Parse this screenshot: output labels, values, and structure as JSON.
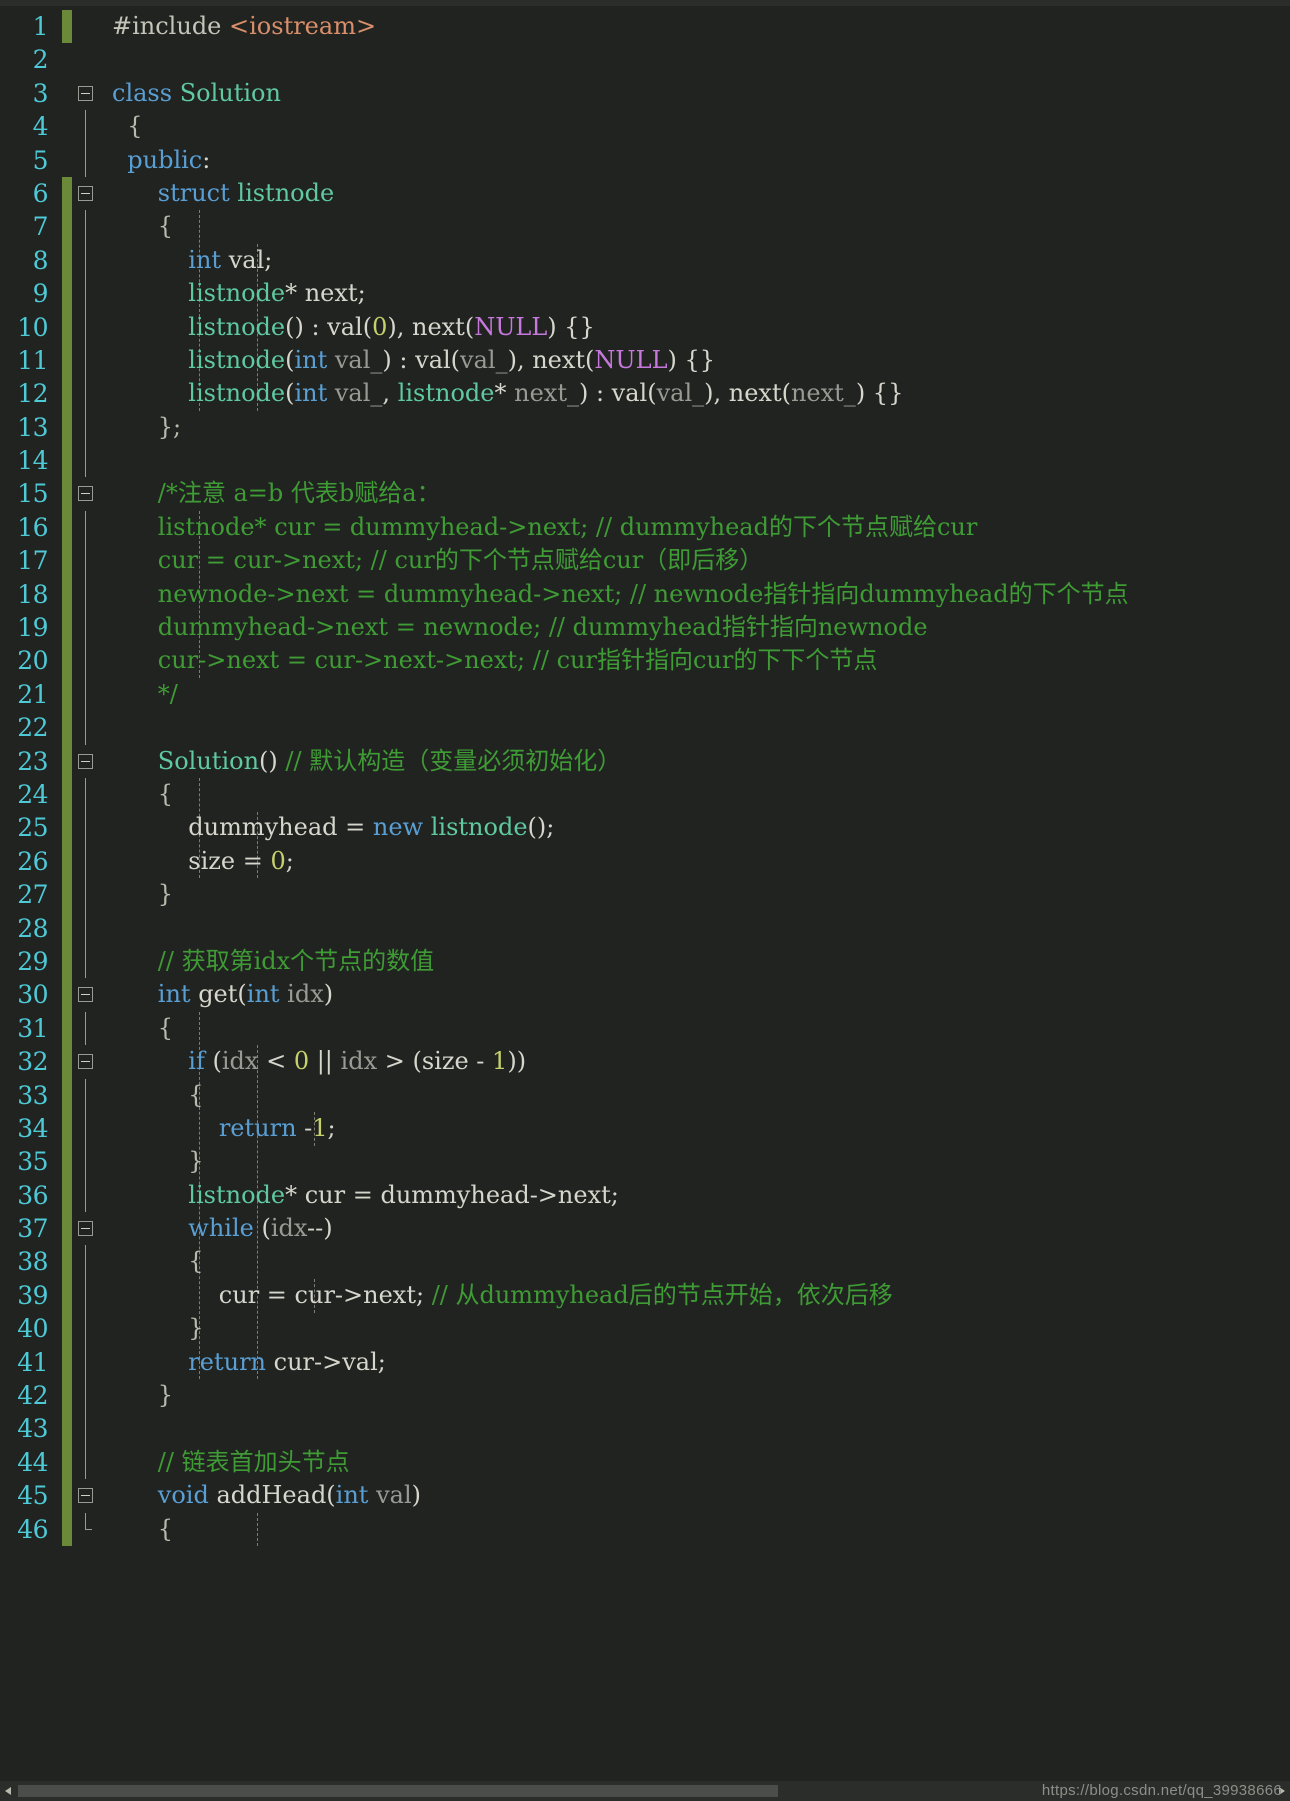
{
  "editor": {
    "language": "C++",
    "theme": "dark",
    "colors": {
      "background": "#212321",
      "line_number": "#4ec9d6",
      "keyword": "#5a9fd4",
      "type": "#5fc9a0",
      "comment": "#3f9c35",
      "string": "#d98f6a",
      "number": "#c6d16b",
      "macro": "#c678dd",
      "parameter": "#9a9a94",
      "plain": "#d6d6cc",
      "change_bar": "#6a8a3a",
      "scrollbar_track": "#2b2d2b",
      "scrollbar_thumb": "#4a4d4a"
    },
    "first_line": 1,
    "last_line": 46,
    "total_visible_lines": 46
  },
  "watermark": "https://blog.csdn.net/qq_39938666",
  "scrollbar": {
    "left_arrow": "scroll-left",
    "right_arrow": "scroll-right"
  },
  "lines": [
    {
      "n": "1",
      "tokens": [
        {
          "t": "#include ",
          "c": "pre"
        },
        {
          "t": "<iostream>",
          "c": "str"
        }
      ]
    },
    {
      "n": "2",
      "tokens": []
    },
    {
      "n": "3",
      "tokens": [
        {
          "t": "class ",
          "c": "kw"
        },
        {
          "t": "Solution",
          "c": "typ"
        }
      ]
    },
    {
      "n": "4",
      "tokens": [
        {
          "t": "  {",
          "c": "brc"
        }
      ]
    },
    {
      "n": "5",
      "tokens": [
        {
          "t": "  ",
          "c": "pln"
        },
        {
          "t": "public",
          "c": "kw"
        },
        {
          "t": ":",
          "c": "pln"
        }
      ]
    },
    {
      "n": "6",
      "tokens": [
        {
          "t": "      ",
          "c": "pln"
        },
        {
          "t": "struct ",
          "c": "kw"
        },
        {
          "t": "listnode",
          "c": "typ"
        }
      ]
    },
    {
      "n": "7",
      "tokens": [
        {
          "t": "      {",
          "c": "brc"
        }
      ]
    },
    {
      "n": "8",
      "tokens": [
        {
          "t": "          ",
          "c": "pln"
        },
        {
          "t": "int ",
          "c": "kw"
        },
        {
          "t": "val;",
          "c": "pln"
        }
      ]
    },
    {
      "n": "9",
      "tokens": [
        {
          "t": "          ",
          "c": "pln"
        },
        {
          "t": "listnode",
          "c": "typ"
        },
        {
          "t": "* next;",
          "c": "pln"
        }
      ]
    },
    {
      "n": "10",
      "tokens": [
        {
          "t": "          ",
          "c": "pln"
        },
        {
          "t": "listnode",
          "c": "typ"
        },
        {
          "t": "() : val(",
          "c": "pln"
        },
        {
          "t": "0",
          "c": "num"
        },
        {
          "t": "), next(",
          "c": "pln"
        },
        {
          "t": "NULL",
          "c": "mac"
        },
        {
          "t": ") {}",
          "c": "pln"
        }
      ]
    },
    {
      "n": "11",
      "tokens": [
        {
          "t": "          ",
          "c": "pln"
        },
        {
          "t": "listnode",
          "c": "typ"
        },
        {
          "t": "(",
          "c": "pln"
        },
        {
          "t": "int ",
          "c": "kw"
        },
        {
          "t": "val_",
          "c": "par"
        },
        {
          "t": ") : val(",
          "c": "pln"
        },
        {
          "t": "val_",
          "c": "par"
        },
        {
          "t": "), next(",
          "c": "pln"
        },
        {
          "t": "NULL",
          "c": "mac"
        },
        {
          "t": ") {}",
          "c": "pln"
        }
      ]
    },
    {
      "n": "12",
      "tokens": [
        {
          "t": "          ",
          "c": "pln"
        },
        {
          "t": "listnode",
          "c": "typ"
        },
        {
          "t": "(",
          "c": "pln"
        },
        {
          "t": "int ",
          "c": "kw"
        },
        {
          "t": "val_",
          "c": "par"
        },
        {
          "t": ", ",
          "c": "pln"
        },
        {
          "t": "listnode",
          "c": "typ"
        },
        {
          "t": "* ",
          "c": "pln"
        },
        {
          "t": "next_",
          "c": "par"
        },
        {
          "t": ") : val(",
          "c": "pln"
        },
        {
          "t": "val_",
          "c": "par"
        },
        {
          "t": "), next(",
          "c": "pln"
        },
        {
          "t": "next_",
          "c": "par"
        },
        {
          "t": ") {}",
          "c": "pln"
        }
      ]
    },
    {
      "n": "13",
      "tokens": [
        {
          "t": "      };",
          "c": "brc"
        }
      ]
    },
    {
      "n": "14",
      "tokens": []
    },
    {
      "n": "15",
      "tokens": [
        {
          "t": "      /*注意 a=b 代表b赋给a：",
          "c": "cmt"
        }
      ]
    },
    {
      "n": "16",
      "tokens": [
        {
          "t": "      listnode* cur = dummyhead->next; // dummyhead的下个节点赋给cur",
          "c": "cmt"
        }
      ]
    },
    {
      "n": "17",
      "tokens": [
        {
          "t": "      cur = cur->next; // cur的下个节点赋给cur（即后移）",
          "c": "cmt"
        }
      ]
    },
    {
      "n": "18",
      "tokens": [
        {
          "t": "      newnode->next = dummyhead->next; // newnode指针指向dummyhead的下个节点",
          "c": "cmt"
        }
      ]
    },
    {
      "n": "19",
      "tokens": [
        {
          "t": "      dummyhead->next = newnode; // dummyhead指针指向newnode",
          "c": "cmt"
        }
      ]
    },
    {
      "n": "20",
      "tokens": [
        {
          "t": "      cur->next = cur->next->next; // cur指针指向cur的下下个节点",
          "c": "cmt"
        }
      ]
    },
    {
      "n": "21",
      "tokens": [
        {
          "t": "      */",
          "c": "cmt"
        }
      ]
    },
    {
      "n": "22",
      "tokens": []
    },
    {
      "n": "23",
      "tokens": [
        {
          "t": "      ",
          "c": "pln"
        },
        {
          "t": "Solution",
          "c": "typ"
        },
        {
          "t": "() ",
          "c": "pln"
        },
        {
          "t": "// 默认构造（变量必须初始化）",
          "c": "cmt"
        }
      ]
    },
    {
      "n": "24",
      "tokens": [
        {
          "t": "      {",
          "c": "brc"
        }
      ]
    },
    {
      "n": "25",
      "tokens": [
        {
          "t": "          dummyhead = ",
          "c": "pln"
        },
        {
          "t": "new ",
          "c": "kw"
        },
        {
          "t": "listnode",
          "c": "typ"
        },
        {
          "t": "();",
          "c": "pln"
        }
      ]
    },
    {
      "n": "26",
      "tokens": [
        {
          "t": "          size = ",
          "c": "pln"
        },
        {
          "t": "0",
          "c": "num"
        },
        {
          "t": ";",
          "c": "pln"
        }
      ]
    },
    {
      "n": "27",
      "tokens": [
        {
          "t": "      }",
          "c": "brc"
        }
      ]
    },
    {
      "n": "28",
      "tokens": []
    },
    {
      "n": "29",
      "tokens": [
        {
          "t": "      // 获取第idx个节点的数值",
          "c": "cmt"
        }
      ]
    },
    {
      "n": "30",
      "tokens": [
        {
          "t": "      ",
          "c": "pln"
        },
        {
          "t": "int ",
          "c": "kw"
        },
        {
          "t": "get(",
          "c": "pln"
        },
        {
          "t": "int ",
          "c": "kw"
        },
        {
          "t": "idx",
          "c": "par"
        },
        {
          "t": ")",
          "c": "pln"
        }
      ]
    },
    {
      "n": "31",
      "tokens": [
        {
          "t": "      {",
          "c": "brc"
        }
      ]
    },
    {
      "n": "32",
      "tokens": [
        {
          "t": "          ",
          "c": "pln"
        },
        {
          "t": "if ",
          "c": "kw"
        },
        {
          "t": "(",
          "c": "pln"
        },
        {
          "t": "idx",
          "c": "par"
        },
        {
          "t": " < ",
          "c": "pln"
        },
        {
          "t": "0",
          "c": "num"
        },
        {
          "t": " || ",
          "c": "pln"
        },
        {
          "t": "idx",
          "c": "par"
        },
        {
          "t": " > (size - ",
          "c": "pln"
        },
        {
          "t": "1",
          "c": "num"
        },
        {
          "t": "))",
          "c": "pln"
        }
      ]
    },
    {
      "n": "33",
      "tokens": [
        {
          "t": "          {",
          "c": "brc"
        }
      ]
    },
    {
      "n": "34",
      "tokens": [
        {
          "t": "              ",
          "c": "pln"
        },
        {
          "t": "return ",
          "c": "kw"
        },
        {
          "t": "-",
          "c": "pln"
        },
        {
          "t": "1",
          "c": "num"
        },
        {
          "t": ";",
          "c": "pln"
        }
      ]
    },
    {
      "n": "35",
      "tokens": [
        {
          "t": "          }",
          "c": "brc"
        }
      ]
    },
    {
      "n": "36",
      "tokens": [
        {
          "t": "          ",
          "c": "pln"
        },
        {
          "t": "listnode",
          "c": "typ"
        },
        {
          "t": "* cur = dummyhead->next;",
          "c": "pln"
        }
      ]
    },
    {
      "n": "37",
      "tokens": [
        {
          "t": "          ",
          "c": "pln"
        },
        {
          "t": "while ",
          "c": "kw"
        },
        {
          "t": "(",
          "c": "pln"
        },
        {
          "t": "idx",
          "c": "par"
        },
        {
          "t": "--)",
          "c": "pln"
        }
      ]
    },
    {
      "n": "38",
      "tokens": [
        {
          "t": "          {",
          "c": "brc"
        }
      ]
    },
    {
      "n": "39",
      "tokens": [
        {
          "t": "              cur = cur->next; ",
          "c": "pln"
        },
        {
          "t": "// 从dummyhead后的节点开始，依次后移",
          "c": "cmt"
        }
      ]
    },
    {
      "n": "40",
      "tokens": [
        {
          "t": "          }",
          "c": "brc"
        }
      ]
    },
    {
      "n": "41",
      "tokens": [
        {
          "t": "          ",
          "c": "pln"
        },
        {
          "t": "return ",
          "c": "kw"
        },
        {
          "t": "cur->val;",
          "c": "pln"
        }
      ]
    },
    {
      "n": "42",
      "tokens": [
        {
          "t": "      }",
          "c": "brc"
        }
      ]
    },
    {
      "n": "43",
      "tokens": []
    },
    {
      "n": "44",
      "tokens": [
        {
          "t": "      // 链表首加头节点",
          "c": "cmt"
        }
      ]
    },
    {
      "n": "45",
      "tokens": [
        {
          "t": "      ",
          "c": "pln"
        },
        {
          "t": "void ",
          "c": "kw"
        },
        {
          "t": "addHead(",
          "c": "pln"
        },
        {
          "t": "int ",
          "c": "kw"
        },
        {
          "t": "val",
          "c": "par"
        },
        {
          "t": ")",
          "c": "pln"
        }
      ]
    },
    {
      "n": "46",
      "tokens": [
        {
          "t": "      {",
          "c": "brc"
        }
      ]
    }
  ],
  "change_bar_lines": [
    1,
    6,
    7,
    8,
    9,
    10,
    11,
    12,
    13,
    14,
    15,
    16,
    17,
    18,
    19,
    20,
    21,
    22,
    23,
    24,
    25,
    26,
    27,
    28,
    29,
    30,
    31,
    32,
    33,
    34,
    35,
    36,
    37,
    38,
    39,
    40,
    41,
    42,
    43,
    44,
    45,
    46
  ],
  "fold_markers": [
    {
      "line": 3,
      "state": "expanded"
    },
    {
      "line": 6,
      "state": "expanded"
    },
    {
      "line": 15,
      "state": "expanded"
    },
    {
      "line": 23,
      "state": "expanded"
    },
    {
      "line": 30,
      "state": "expanded"
    },
    {
      "line": 32,
      "state": "expanded"
    },
    {
      "line": 37,
      "state": "expanded"
    },
    {
      "line": 45,
      "state": "expanded"
    }
  ]
}
